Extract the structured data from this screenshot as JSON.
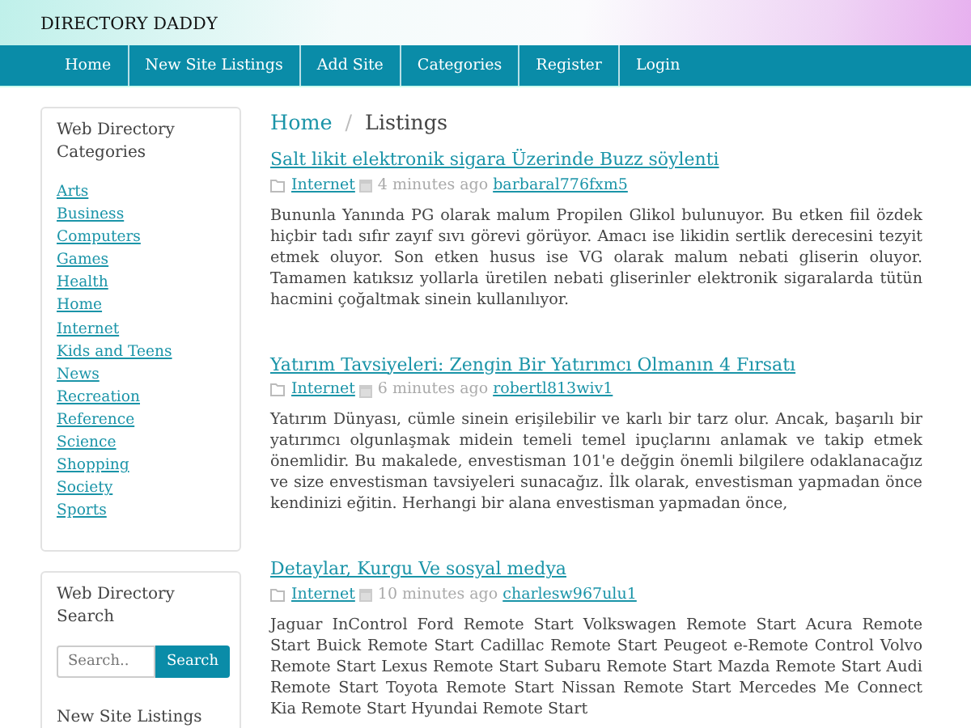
{
  "site_title": "DIRECTORY DADDY",
  "nav": [
    {
      "label": "Home"
    },
    {
      "label": "New Site Listings"
    },
    {
      "label": "Add Site"
    },
    {
      "label": "Categories"
    },
    {
      "label": "Register"
    },
    {
      "label": "Login"
    }
  ],
  "sidebar": {
    "categories_title": "Web Directory Categories",
    "categories": [
      "Arts",
      "Business",
      "Computers",
      "Games",
      "Health",
      "Home",
      "Internet",
      "Kids and Teens",
      "News",
      "Recreation",
      "Reference",
      "Science",
      "Shopping",
      "Society",
      "Sports"
    ],
    "search_title": "Web Directory Search",
    "search": {
      "placeholder": "Search..",
      "button": "Search"
    },
    "new_listings_title": "New Site Listings"
  },
  "breadcrumb": [
    "Home",
    "Listings"
  ],
  "breadcrumb_separator": "/",
  "listings": [
    {
      "title": "Salt likit elektronik sigara Üzerinde Buzz söylenti",
      "category": "Internet",
      "time": "4 minutes ago",
      "author": "barbaral776fxm5",
      "text": "Bununla Yanında PG olarak malum Propilen Glikol bulunuyor. Bu etken fiil özdek hiçbir tadı sıfır zayıf sıvı görevi görüyor. Amacı ise likidin sertlik derecesini tezyit etmek oluyor. Son etken husus ise VG olarak malum nebati gliserin oluyor. Tamamen katıksız yollarla üretilen nebati gliserinler elektronik sigaralarda tütün hacmini çoğaltmak sinein kullanılıyor."
    },
    {
      "title": "Yatırım Tavsiyeleri: Zengin Bir Yatırımcı Olmanın 4 Fırsatı",
      "category": "Internet",
      "time": "6 minutes ago",
      "author": "robertl813wiv1",
      "text": "Yatırım Dünyası, cümle sinein erişilebilir ve karlı bir tarz olur. Ancak, başarılı bir yatırımcı olgunlaşmak midein temeli temel ipuçlarını anlamak ve takip etmek önemlidir. Bu makalede, envestisman 101'e değgin önemli bilgilere odaklanacağız ve size envestisman tavsiyeleri sunacağız. İlk olarak, envestisman yapmadan önce kendinizi eğitin. Herhangi bir alana envestisman yapmadan önce,"
    },
    {
      "title": "Detaylar, Kurgu Ve sosyal medya",
      "category": "Internet",
      "time": "10 minutes ago",
      "author": "charlesw967ulu1",
      "text": "Jaguar InControl Ford Remote Start Volkswagen Remote Start Acura Remote Start Buick Remote Start Cadillac Remote Start Peugeot e-Remote Control Volvo Remote Start Lexus Remote Start Subaru Remote Start Mazda Remote Start Audi Remote Start Toyota Remote Start Nissan Remote Start Mercedes Me Connect Kia Remote Start Hyundai Remote Start"
    }
  ]
}
